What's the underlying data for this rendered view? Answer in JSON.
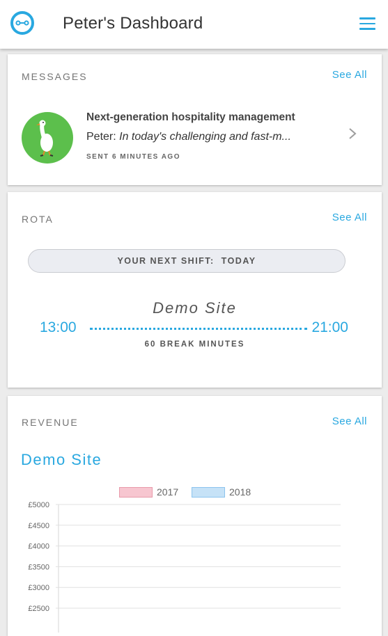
{
  "header": {
    "title": "Peter's Dashboard",
    "logo_icon": "logo-icon",
    "menu_icon": "hamburger-menu-icon"
  },
  "messages": {
    "heading": "MESSAGES",
    "see_all": "See All",
    "item": {
      "title": "Next-generation hospitality management",
      "sender": "Peter:",
      "body": "In today's challenging and fast-m...",
      "time": "SENT 6 MINUTES AGO",
      "avatar_icon": "goose-avatar-icon"
    }
  },
  "rota": {
    "heading": "ROTA",
    "see_all": "See All",
    "next_shift": "YOUR NEXT SHIFT:  TODAY",
    "site": "Demo Site",
    "start": "13:00",
    "end": "21:00",
    "break": "60 BREAK MINUTES"
  },
  "revenue": {
    "heading": "REVENUE",
    "see_all": "See All",
    "site": "Demo Site"
  },
  "colors": {
    "accent": "#29a8e0",
    "avatar_bg": "#5cbf4c",
    "series_2017": "#f7c6d0",
    "series_2018": "#c6e2f7"
  },
  "chart_data": {
    "type": "bar",
    "series": [
      {
        "name": "2017",
        "values": []
      },
      {
        "name": "2018",
        "values": []
      }
    ],
    "y_ticks": [
      "£5000",
      "£4500",
      "£4000",
      "£3500",
      "£3000",
      "£2500"
    ],
    "ylim": [
      2500,
      5000
    ],
    "grid": true,
    "legend_position": "top"
  }
}
